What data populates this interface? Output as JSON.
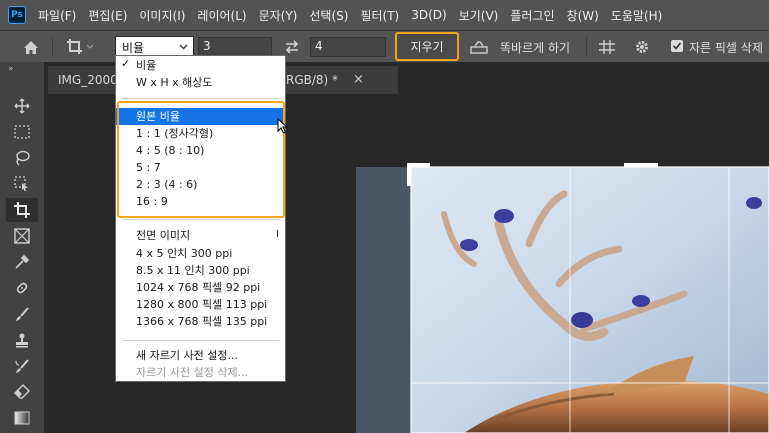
{
  "app": {
    "logo_text": "Ps",
    "accent_color": "#31a8ff",
    "highlight_color": "#f4a51c"
  },
  "menu": [
    "파일(F)",
    "편집(E)",
    "이미지(I)",
    "레이어(L)",
    "문자(Y)",
    "선택(S)",
    "필터(T)",
    "3D(D)",
    "보기(V)",
    "플러그인",
    "창(W)",
    "도움말(H)"
  ],
  "options_bar": {
    "ratio_select": "비율",
    "width_value": "3",
    "height_value": "4",
    "clear_button": "지우기",
    "straighten_label": "똑바르게 하기",
    "delete_pixels_label": "자른 픽셀 삭제"
  },
  "document_tab": {
    "name_start": "IMG_2000.J",
    "name_end": "RGB/8) *",
    "close": "×"
  },
  "dropdown": {
    "group1": [
      "비율",
      "W x H x 해상도"
    ],
    "group2": [
      "원본 비율",
      "1 : 1 (정사각형)",
      "4 : 5 (8 : 10)",
      "5 : 7",
      "2 : 3 (4 : 6)",
      "16 : 9"
    ],
    "group3": [
      "전면 이미지",
      "4 x 5 인치 300 ppi",
      "8.5 x 11 인치 300 ppi",
      "1024 x 768 픽셀 92 ppi",
      "1280 x 800 픽셀 113 ppi",
      "1366 x 768 픽셀 135 ppi"
    ],
    "group4": [
      "새 자르기 사전 설정...",
      "자르기 사전 설정 삭제..."
    ],
    "front_image_shortcut": "I",
    "checkmark": "✓"
  }
}
